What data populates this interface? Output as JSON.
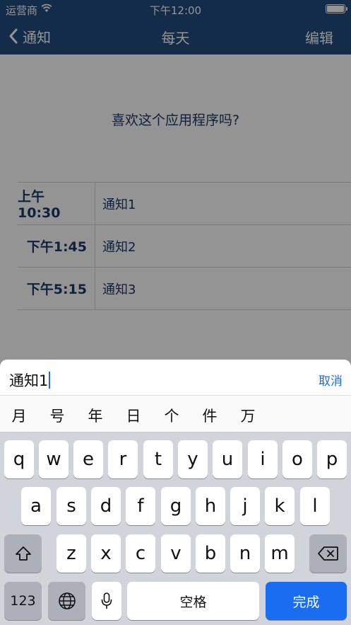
{
  "status_bar": {
    "carrier": "运营商",
    "time": "下午12:00",
    "wifi_icon": "wifi-icon",
    "battery_icon": "battery-icon"
  },
  "nav": {
    "back_label": "通知",
    "title": "每天",
    "edit_label": "编辑"
  },
  "content": {
    "prompt": "喜欢这个应用程序吗?",
    "notifications": [
      {
        "time": "上午10:30",
        "label": "通知1"
      },
      {
        "time": "下午1:45",
        "label": "通知2"
      },
      {
        "time": "下午5:15",
        "label": "通知3"
      }
    ]
  },
  "input_bar": {
    "value": "通知1",
    "cancel_label": "取消"
  },
  "candidates": [
    "月",
    "号",
    "年",
    "日",
    "个",
    "件",
    "万"
  ],
  "keyboard": {
    "row1": [
      "q",
      "w",
      "e",
      "r",
      "t",
      "y",
      "u",
      "i",
      "o",
      "p"
    ],
    "row2": [
      "a",
      "s",
      "d",
      "f",
      "g",
      "h",
      "j",
      "k",
      "l"
    ],
    "row3": [
      "z",
      "x",
      "c",
      "v",
      "b",
      "n",
      "m"
    ],
    "numbers_label": "123",
    "space_label": "空格",
    "done_label": "完成"
  },
  "colors": {
    "navbar": "#1f4d80",
    "text_dark_blue": "#1d3a66",
    "accent_blue": "#1a6cf0"
  }
}
